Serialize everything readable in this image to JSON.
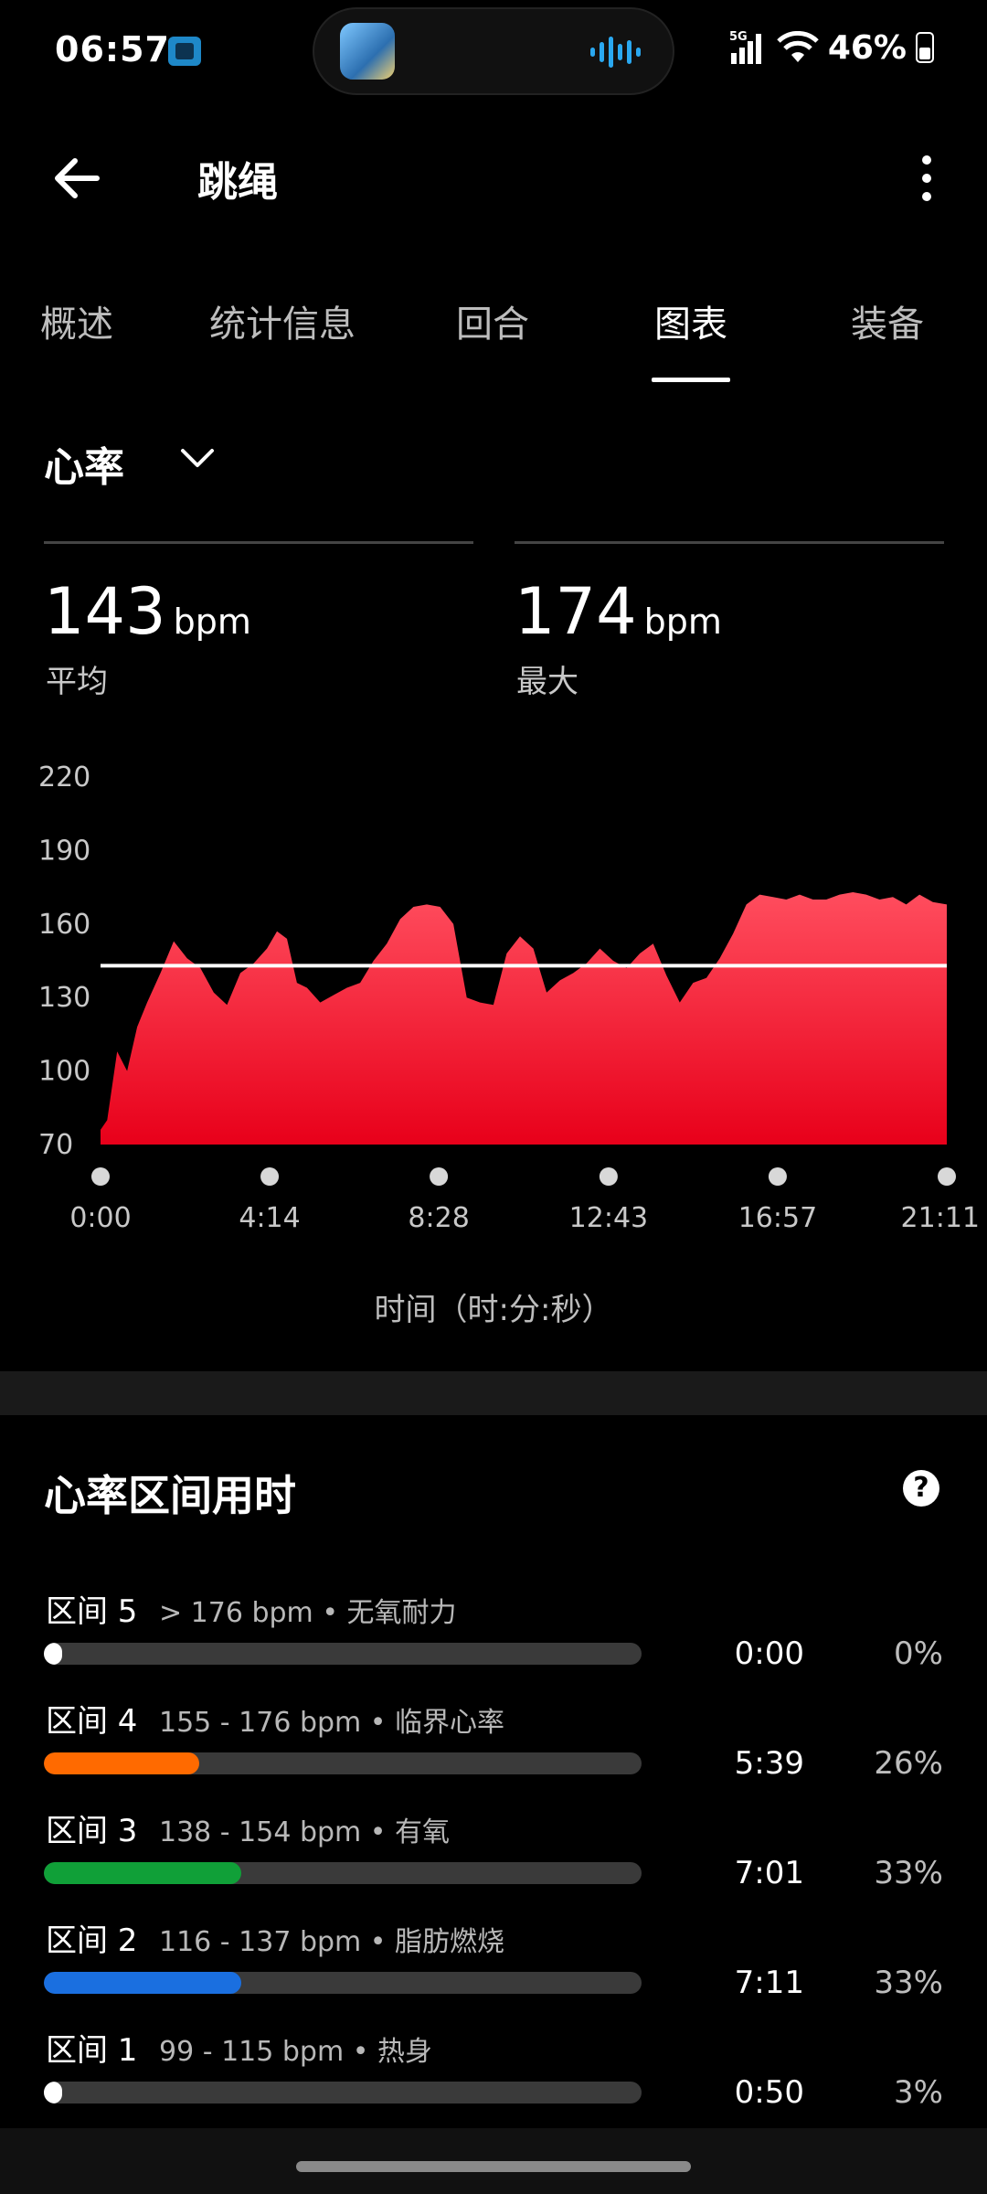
{
  "status_bar": {
    "time": "06:57",
    "network": "5G",
    "battery": "46%"
  },
  "header": {
    "title": "跳绳"
  },
  "tabs": [
    {
      "label": "概述",
      "active": false
    },
    {
      "label": "统计信息",
      "active": false
    },
    {
      "label": "回合",
      "active": false
    },
    {
      "label": "图表",
      "active": true
    },
    {
      "label": "装备",
      "active": false
    }
  ],
  "metric_selector": {
    "label": "心率"
  },
  "stats": {
    "avg": {
      "value": "143",
      "unit": "bpm",
      "label": "平均"
    },
    "max": {
      "value": "174",
      "unit": "bpm",
      "label": "最大"
    }
  },
  "chart_caption": "时间（时:分:秒）",
  "chart_data": {
    "type": "area",
    "xlabel": "时间（时:分:秒）",
    "ylabel": "",
    "yticks": [
      70,
      100,
      130,
      160,
      190,
      220
    ],
    "ylim": [
      70,
      220
    ],
    "xticks": [
      "0:00",
      "4:14",
      "8:28",
      "12:43",
      "16:57",
      "21:11"
    ],
    "x_unit_seconds": [
      0,
      254,
      508,
      763,
      1017,
      1271
    ],
    "average_line": 143,
    "color": "#ff1a33",
    "x": [
      0,
      10,
      25,
      40,
      55,
      70,
      90,
      110,
      130,
      150,
      170,
      190,
      210,
      230,
      250,
      265,
      280,
      295,
      310,
      330,
      350,
      370,
      390,
      410,
      430,
      450,
      470,
      490,
      510,
      530,
      550,
      570,
      590,
      610,
      630,
      650,
      670,
      690,
      710,
      730,
      750,
      770,
      790,
      810,
      830,
      850,
      870,
      890,
      910,
      930,
      950,
      970,
      990,
      1010,
      1030,
      1050,
      1070,
      1090,
      1110,
      1130,
      1150,
      1170,
      1190,
      1210,
      1230,
      1250,
      1271
    ],
    "y": [
      76,
      80,
      108,
      100,
      118,
      128,
      140,
      153,
      146,
      142,
      132,
      127,
      140,
      144,
      150,
      157,
      154,
      136,
      134,
      128,
      131,
      134,
      136,
      145,
      152,
      162,
      167,
      168,
      167,
      160,
      130,
      128,
      127,
      148,
      155,
      150,
      132,
      137,
      140,
      144,
      150,
      145,
      142,
      148,
      152,
      139,
      128,
      136,
      138,
      146,
      156,
      168,
      172,
      171,
      170,
      172,
      170,
      170,
      172,
      173,
      172,
      170,
      171,
      168,
      172,
      169,
      168
    ]
  },
  "zones": {
    "title": "心率区间用时",
    "items": [
      {
        "name": "区间 5",
        "desc": "> 176 bpm • 无氧耐力",
        "time": "0:00",
        "pct": "0%",
        "fraction": 0.0,
        "color": "#ffffff"
      },
      {
        "name": "区间 4",
        "desc": "155 - 176 bpm • 临界心率",
        "time": "5:39",
        "pct": "26%",
        "fraction": 0.26,
        "color": "#ff6a00"
      },
      {
        "name": "区间 3",
        "desc": "138 - 154 bpm • 有氧",
        "time": "7:01",
        "pct": "33%",
        "fraction": 0.33,
        "color": "#10a038"
      },
      {
        "name": "区间 2",
        "desc": "116 - 137 bpm • 脂肪燃烧",
        "time": "7:11",
        "pct": "33%",
        "fraction": 0.33,
        "color": "#1a6fe0"
      },
      {
        "name": "区间 1",
        "desc": "99 - 115 bpm • 热身",
        "time": "0:50",
        "pct": "3%",
        "fraction": 0.03,
        "color": "#ffffff"
      }
    ]
  },
  "icons": {
    "back": "arrow-left-icon",
    "more": "more-vertical-icon",
    "chevron": "chevron-down-icon",
    "help": "help-circle-icon",
    "wifi": "wifi-icon",
    "signal": "cell-signal-icon",
    "battery": "battery-icon"
  }
}
